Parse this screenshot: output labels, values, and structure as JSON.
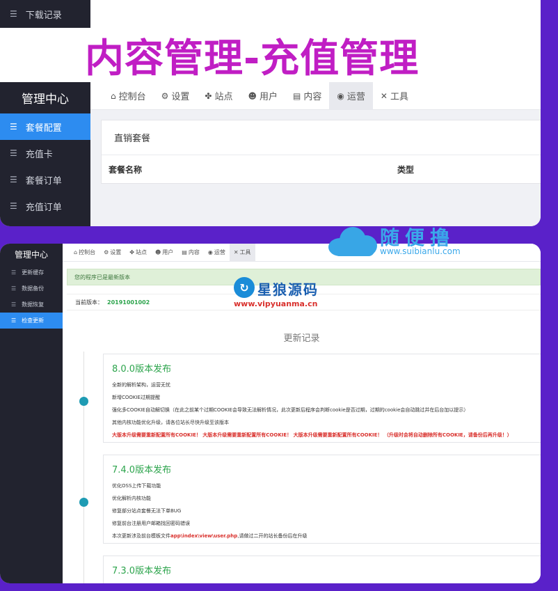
{
  "top": {
    "download_item": "下载记录",
    "banner_title": "内容管理-充值管理",
    "brand": "管理中心",
    "sidebar": [
      {
        "label": "套餐配置",
        "active": true
      },
      {
        "label": "充值卡",
        "active": false
      },
      {
        "label": "套餐订单",
        "active": false
      },
      {
        "label": "充值订单",
        "active": false
      }
    ],
    "nav": [
      {
        "label": "控制台",
        "icon": "home-icon"
      },
      {
        "label": "设置",
        "icon": "gear-icon"
      },
      {
        "label": "站点",
        "icon": "grid-icon"
      },
      {
        "label": "用户",
        "icon": "users-icon"
      },
      {
        "label": "内容",
        "icon": "file-icon"
      },
      {
        "label": "运营",
        "icon": "globe-icon",
        "active": true
      },
      {
        "label": "工具",
        "icon": "wrench-icon"
      }
    ],
    "card_title": "直销套餐",
    "columns": [
      "套餐名称",
      "类型"
    ]
  },
  "bottom": {
    "brand": "管理中心",
    "sidebar": [
      {
        "label": "更新缓存",
        "active": false
      },
      {
        "label": "数据备份",
        "active": false
      },
      {
        "label": "数据恢复",
        "active": false
      },
      {
        "label": "检查更新",
        "active": true
      }
    ],
    "nav": [
      {
        "label": "控制台"
      },
      {
        "label": "设置"
      },
      {
        "label": "站点"
      },
      {
        "label": "用户"
      },
      {
        "label": "内容"
      },
      {
        "label": "运营"
      },
      {
        "label": "工具",
        "active": true
      }
    ],
    "alert": "您的程序已是最新版本",
    "version_label": "当前版本：",
    "version_value": "20191001002",
    "log_title": "更新记录",
    "releases": [
      {
        "title": "8.0.0版本发布",
        "lines": [
          "全新的解析架构，运营无忧",
          "新增COOKIE过期提醒",
          "强化多COOKIE自动解切换（在此之前某个过期COOKIE会导致无法解析情况，此次更新后程序会判断cookie是否过期，过期的cookie会自动跳过并在后台加以提示）",
          "其他内核功能优化升级，请各位站长尽快升级至该版本"
        ],
        "warning": "大版本升级需要重新配置所有COOKIE！ 大版本升级需要重新配置所有COOKIE！ 大版本升级需要重新配置所有COOKIE！ （升级时会将自动删除所有COOKIE，请备份后再升级！）"
      },
      {
        "title": "7.4.0版本发布",
        "lines": [
          "优化OSS上传下载功能",
          "优化解析内核功能",
          "修复部分站点套餐无法下单BUG",
          "修复前台注册用户邮箱找回密码错误"
        ],
        "last_prefix": "本次更新涉及前台模板文件",
        "last_path": "app\\index\\view\\user.php",
        "last_suffix": ",请做过二开的站长备份后在升级"
      },
      {
        "title": "7.3.0版本发布"
      }
    ]
  },
  "watermark1": {
    "text": "随便撸",
    "url": "www.suibianlu.com"
  },
  "watermark2": {
    "text": "星狼源码",
    "url": "www.vipyuanma.cn"
  }
}
